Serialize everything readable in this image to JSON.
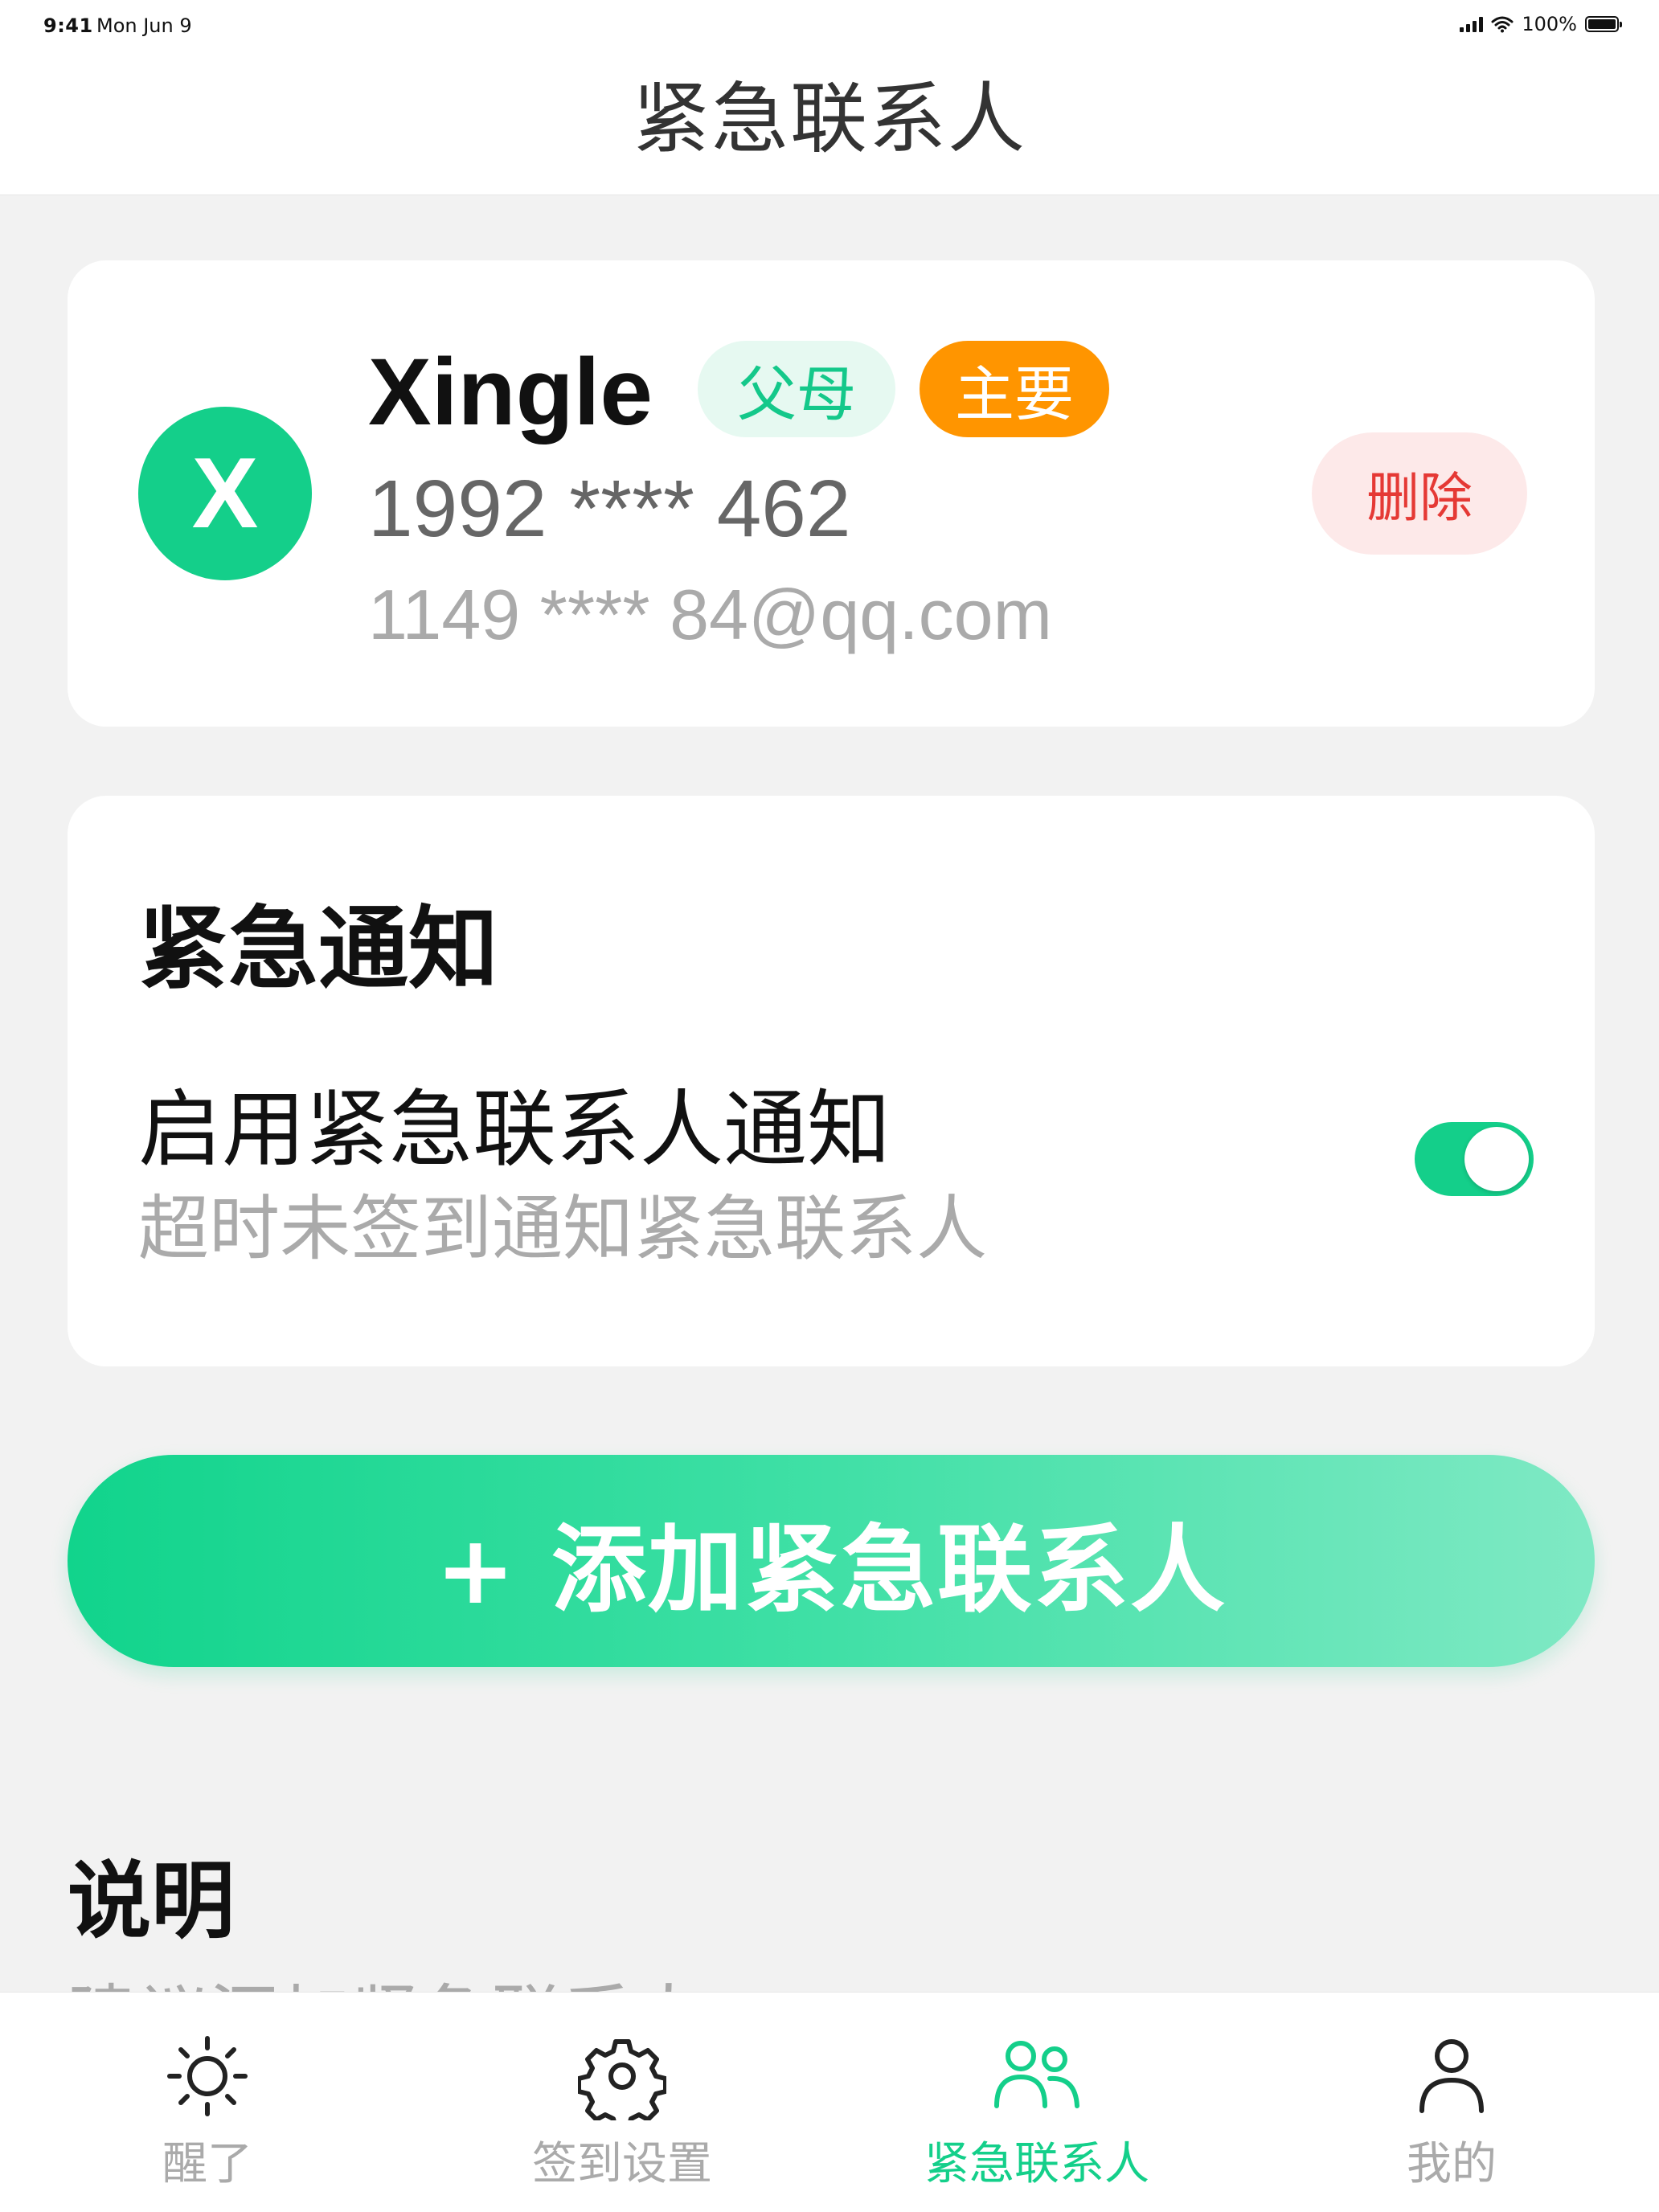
{
  "status_bar": {
    "time": "9:41",
    "date": "Mon Jun 9",
    "battery": "100%"
  },
  "header": {
    "title": "紧急联系人"
  },
  "contact": {
    "avatar_letter": "X",
    "name": "Xingle",
    "relation_tag": "父母",
    "primary_tag": "主要",
    "phone": "1992 **** 462",
    "email": "1149 **** 84@qq.com",
    "delete_label": "删除"
  },
  "notify": {
    "title": "紧急通知",
    "toggle_label": "启用紧急联系人通知",
    "toggle_sub": "超时未签到通知紧急联系人",
    "enabled": true
  },
  "add_button": {
    "label": "+ 添加紧急联系人"
  },
  "explain": {
    "title": "说明",
    "peek_text": "建议添加紧急联系人"
  },
  "tabbar": {
    "tabs": [
      {
        "label": "醒了",
        "icon": "sun-icon",
        "active": false
      },
      {
        "label": "签到设置",
        "icon": "gear-icon",
        "active": false
      },
      {
        "label": "紧急联系人",
        "icon": "people-icon",
        "active": true
      },
      {
        "label": "我的",
        "icon": "person-icon",
        "active": false
      }
    ]
  },
  "colors": {
    "accent": "#14cf8a",
    "orange": "#ff9500",
    "danger": "#e53935",
    "muted": "#aaaaaa"
  }
}
